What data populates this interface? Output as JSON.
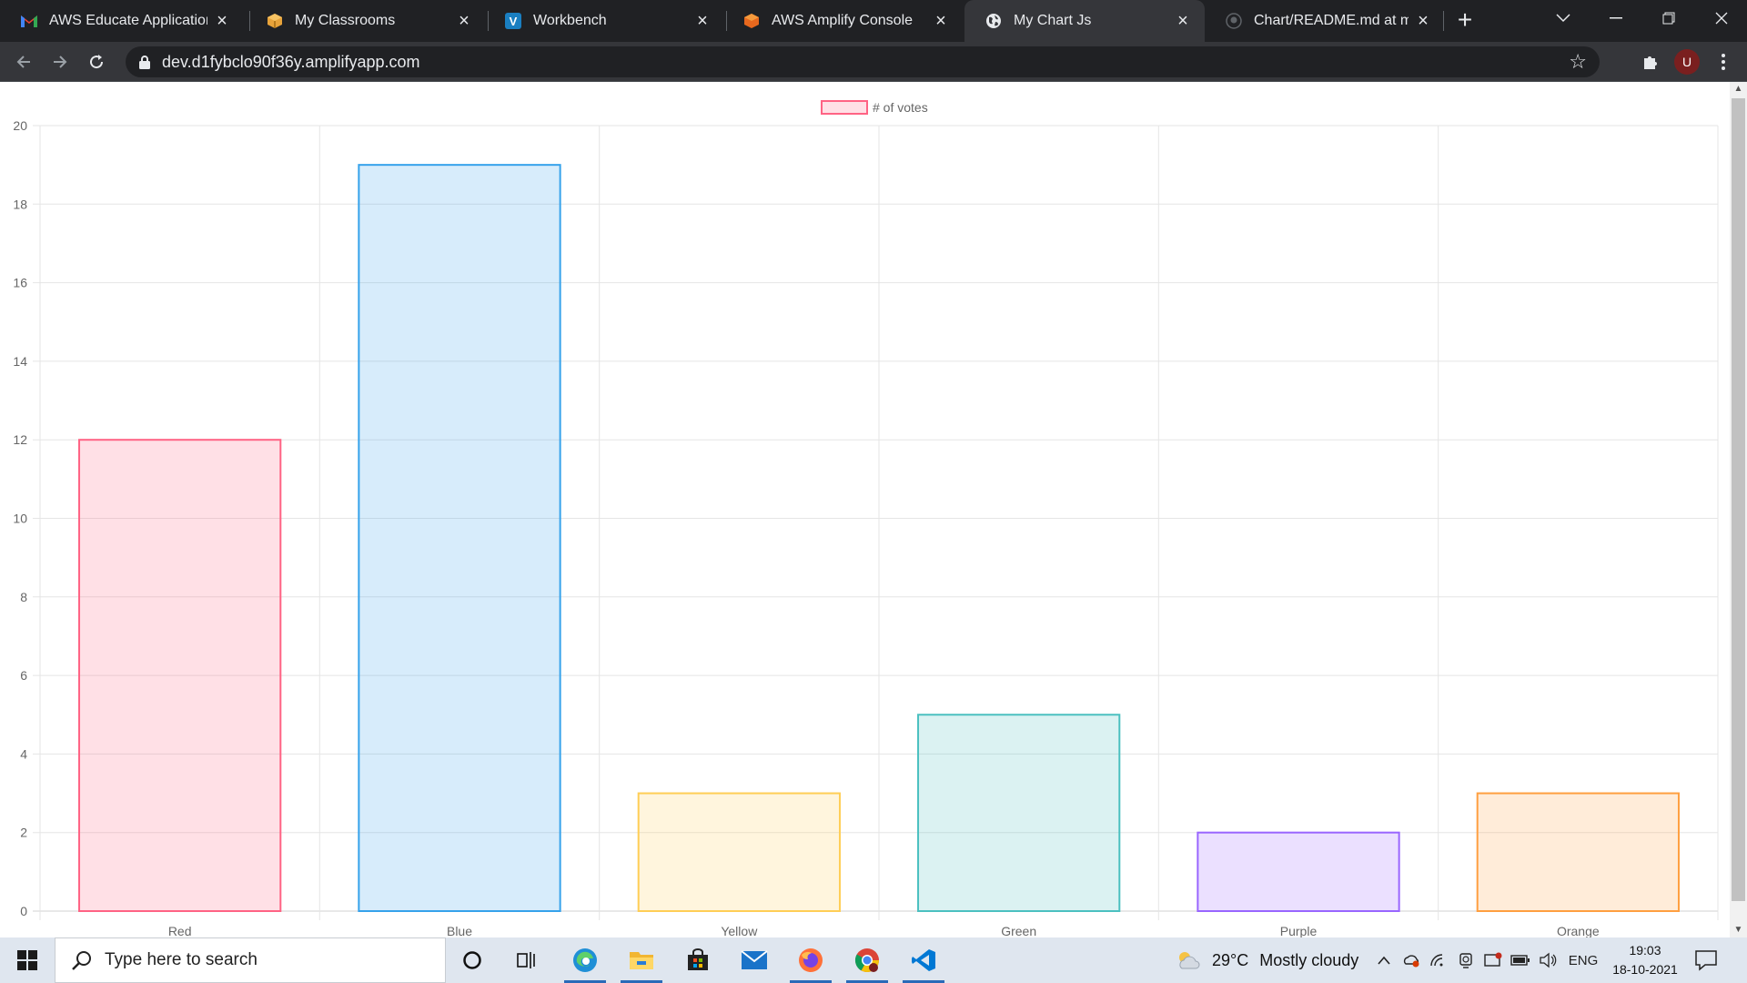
{
  "browser": {
    "tabs": [
      {
        "title": "AWS Educate Application A",
        "icon": "gmail-icon",
        "active": false
      },
      {
        "title": "My Classrooms",
        "icon": "aws-box-icon",
        "active": false
      },
      {
        "title": "Workbench",
        "icon": "vocareum-icon",
        "active": false
      },
      {
        "title": "AWS Amplify Console",
        "icon": "aws-cube-icon",
        "active": false
      },
      {
        "title": "My Chart Js",
        "icon": "globe-icon",
        "active": true
      },
      {
        "title": "Chart/README.md at main",
        "icon": "github-icon",
        "active": false
      }
    ],
    "url": "dev.d1fybclo90f36y.amplifyapp.com",
    "profile_initial": "U",
    "colors": {
      "frame": "#202124",
      "toolbar": "#35363a",
      "omnibox": "#202124",
      "text": "#e8eaed"
    }
  },
  "chart_data": {
    "type": "bar",
    "categories": [
      "Red",
      "Blue",
      "Yellow",
      "Green",
      "Purple",
      "Orange"
    ],
    "series": [
      {
        "name": "# of votes",
        "values": [
          12,
          19,
          3,
          5,
          2,
          3
        ]
      }
    ],
    "colors": {
      "fill": [
        "rgba(255,99,132,0.2)",
        "rgba(54,162,235,0.2)",
        "rgba(255,206,86,0.2)",
        "rgba(75,192,192,0.2)",
        "rgba(153,102,255,0.2)",
        "rgba(255,159,64,0.2)"
      ],
      "border": [
        "#ff6384",
        "#36a2eb",
        "#ffce56",
        "#4bc0c0",
        "#9966ff",
        "#ff9f40"
      ]
    },
    "ylim": [
      0,
      20
    ],
    "yticks": [
      "0",
      "2",
      "4",
      "6",
      "8",
      "10",
      "12",
      "14",
      "16",
      "18",
      "20"
    ],
    "grid": true,
    "legend_position": "top-center",
    "title": "",
    "xlabel": "",
    "ylabel": ""
  },
  "taskbar": {
    "search_placeholder": "Type here to search",
    "apps": [
      "cortana-icon",
      "task-view-icon",
      "edge-icon",
      "file-explorer-icon",
      "store-icon",
      "mail-icon",
      "firefox-icon",
      "chrome-icon",
      "vscode-icon"
    ],
    "weather": {
      "temp": "29°C",
      "condition": "Mostly cloudy"
    },
    "language": "ENG",
    "time": "19:03",
    "date": "18-10-2021"
  }
}
